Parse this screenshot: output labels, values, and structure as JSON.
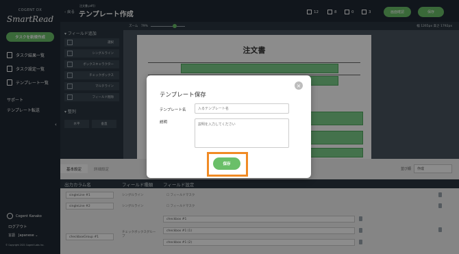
{
  "sidebar": {
    "brand_sub": "COGENT DX",
    "brand": "SmartRead",
    "new_task": "タスクを新規作成",
    "nav": [
      "タスク結果一覧",
      "タスク設定一覧",
      "テンプレート一覧"
    ],
    "support": "サポート",
    "template_transfer": "テンプレート転送",
    "account_name": "Cogent Kanako",
    "logout": "ログアウト",
    "language": "言語　Japanese ⌄",
    "copyright": "© Copyright 2021 Cogent Labs Inc."
  },
  "topbar": {
    "back": "‹ 戻る",
    "breadcrumb": "注文書.pdf()",
    "title": "テンプレート作成",
    "counters": [
      "12",
      "8",
      "0",
      "3"
    ],
    "preview_button": "画面確認",
    "save_button": "保存"
  },
  "toolpanel": {
    "field_add": "▾ フィールド追加",
    "tools": [
      "選択",
      "シングルライン",
      "ボックスキャラクター",
      "チェックボックス",
      "マルチライン",
      "フィールド削除"
    ],
    "align": "▾ 整列",
    "align_buttons": [
      "水平",
      "垂直"
    ]
  },
  "canvas": {
    "zoom_label": "ズーム　79%",
    "dimensions": "幅 1265px 高さ 1792px",
    "doc_title": "注文書"
  },
  "bottom": {
    "tabs": [
      "基本設定",
      "詳細設定"
    ],
    "sort_label": "並び順",
    "sort_value": "作成",
    "headers": [
      "出力カラム名",
      "フィールド種類",
      "フィールド設定"
    ],
    "rows": [
      {
        "name": "singleLine #1",
        "type": "シングルライン",
        "setting": "☐ フィールドマスク"
      },
      {
        "name": "singleLine #2",
        "type": "シングルライン",
        "setting": "☐ フィールドマスク"
      },
      {
        "name": "checkboxGroup #1",
        "type": "チェックボックスグループ",
        "items": [
          "checkbox #1",
          "checkbox #1 (1)",
          "checkbox #1 (2)"
        ]
      }
    ]
  },
  "modal": {
    "title": "テンプレート保存",
    "name_label": "テンプレート名",
    "name_placeholder": "入るテンプレート名",
    "desc_label": "説明",
    "desc_placeholder": "説明を入力してください",
    "save": "保存",
    "close": "×"
  },
  "colors": {
    "accent": "#6abf69",
    "dark": "#1f2933",
    "highlight": "#f08a24"
  }
}
